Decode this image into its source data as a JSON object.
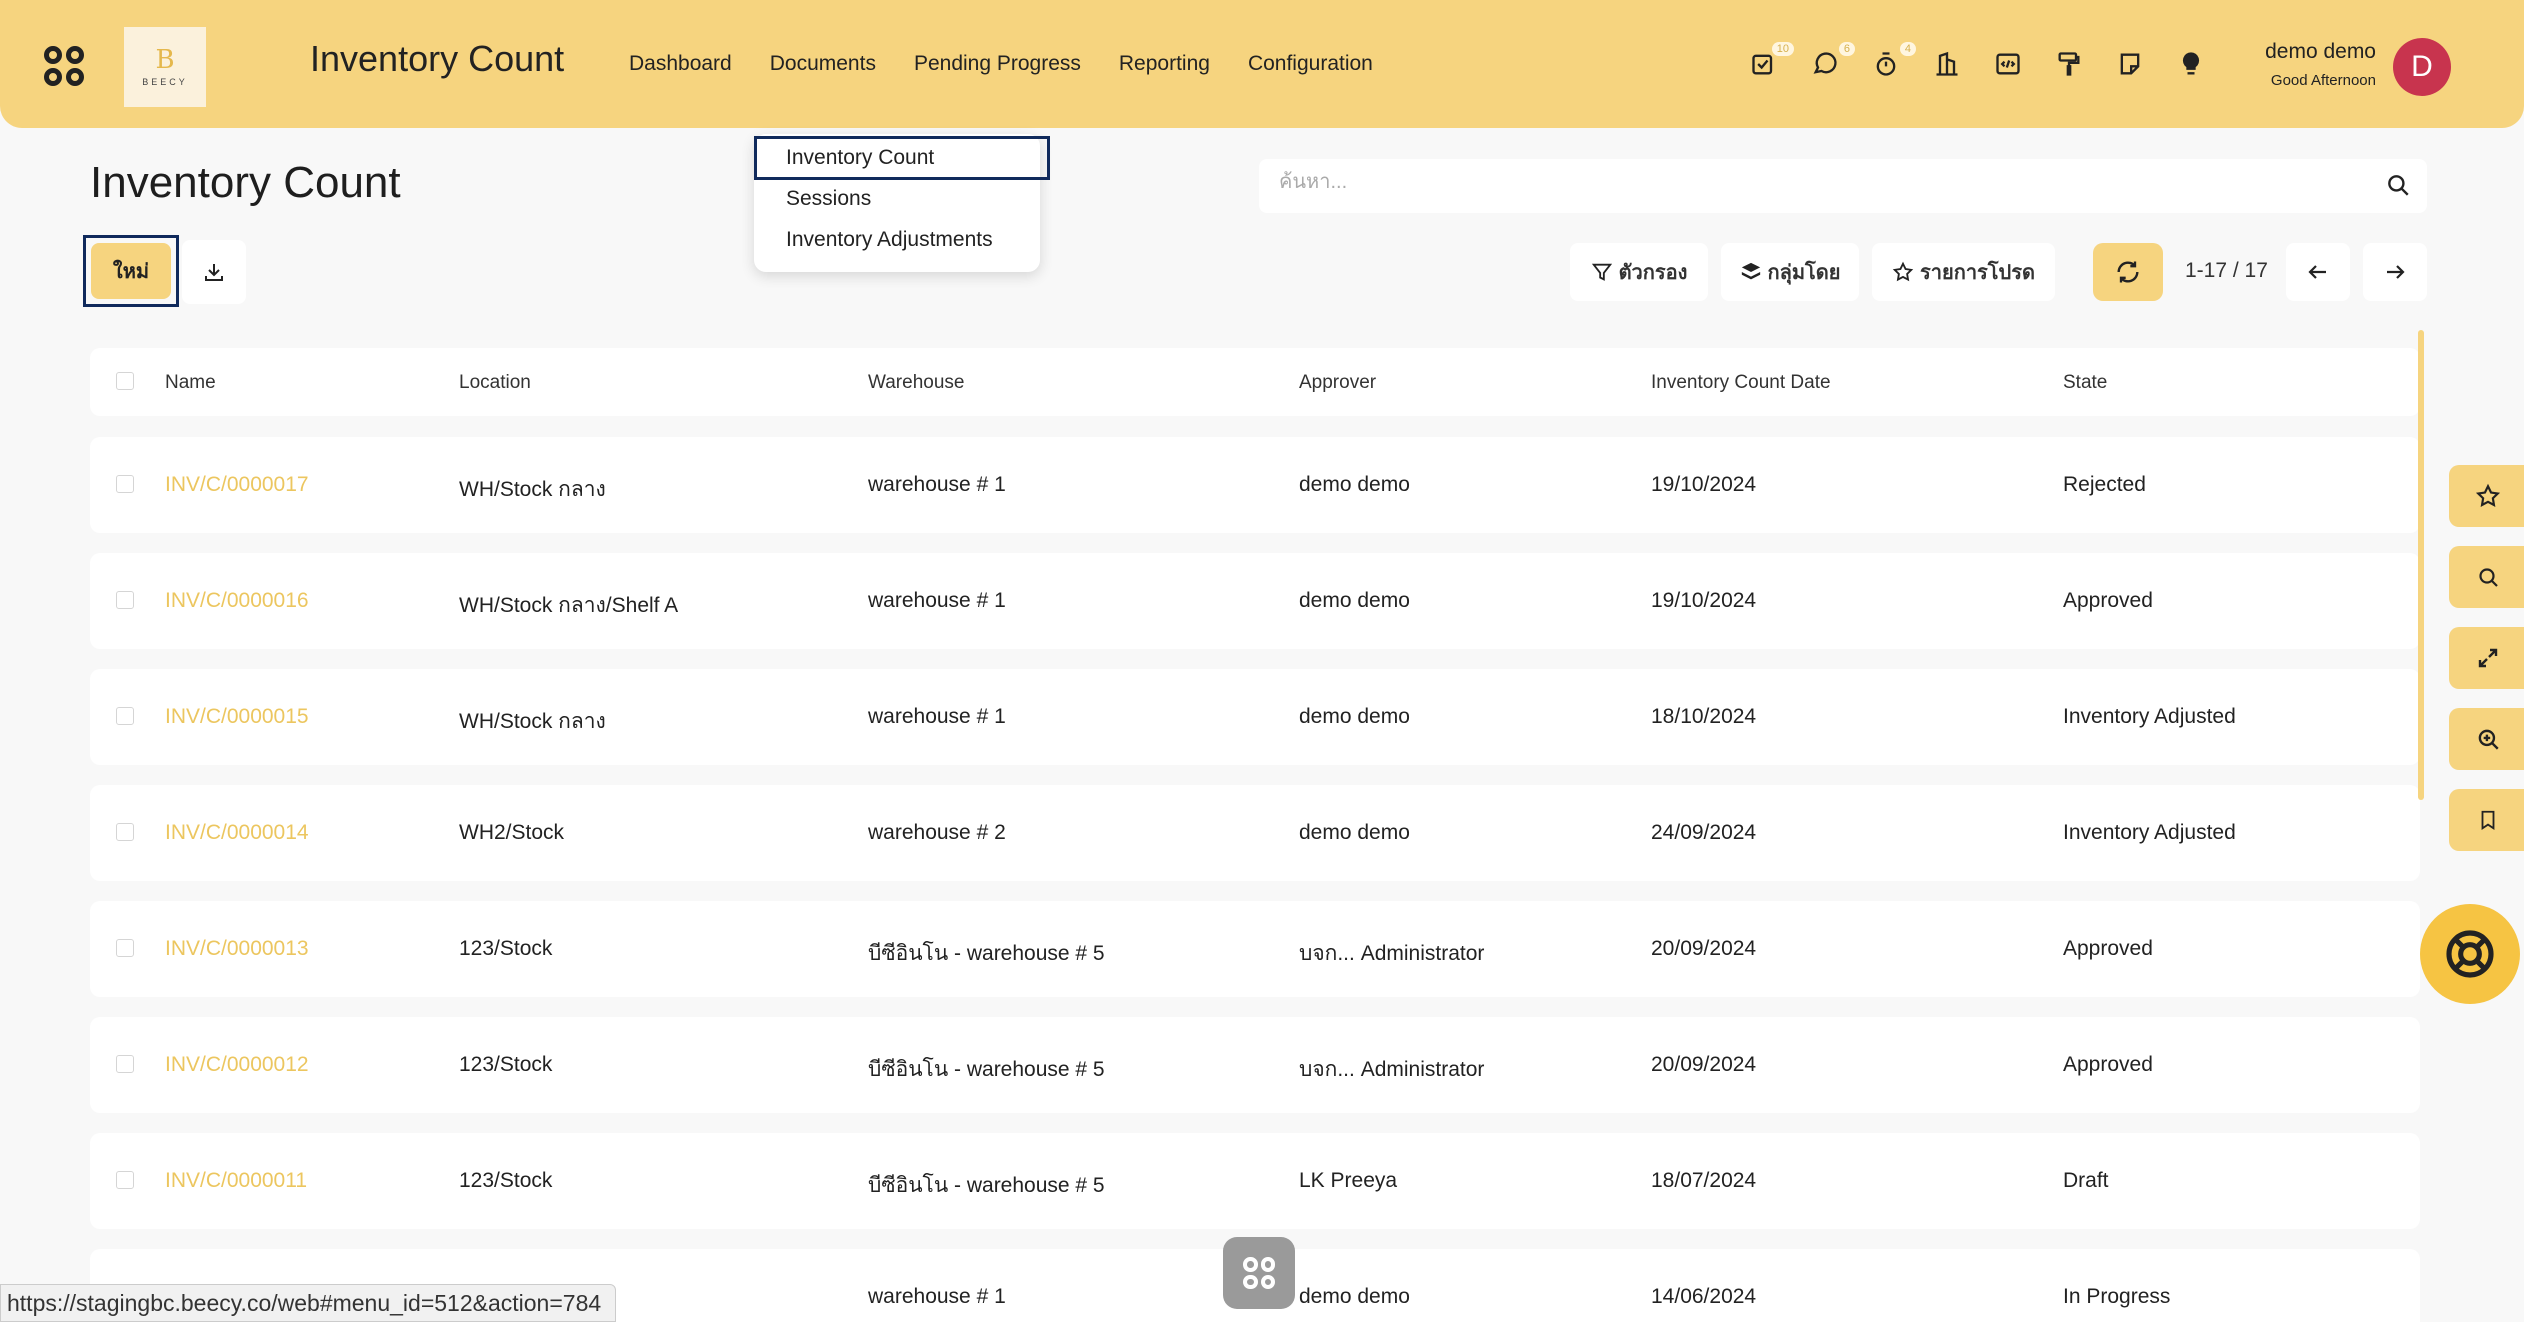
{
  "header": {
    "app_title": "Inventory Count",
    "logo_text": "BEECY",
    "nav": [
      "Dashboard",
      "Documents",
      "Pending Progress",
      "Reporting",
      "Configuration"
    ],
    "icons": [
      {
        "name": "activity-icon",
        "badge": "10"
      },
      {
        "name": "chat-icon",
        "badge": "6"
      },
      {
        "name": "timer-icon",
        "badge": "4"
      },
      {
        "name": "building-icon",
        "badge": ""
      },
      {
        "name": "code-icon",
        "badge": ""
      },
      {
        "name": "paint-roller-icon",
        "badge": ""
      },
      {
        "name": "note-icon",
        "badge": ""
      },
      {
        "name": "lightbulb-icon",
        "badge": ""
      }
    ],
    "user_name": "demo demo",
    "greeting": "Good Afternoon",
    "avatar_letter": "D"
  },
  "page": {
    "title": "Inventory Count",
    "new_label": "ใหม่",
    "search_placeholder": "ค้นหา...",
    "filter_label": "ตัวกรอง",
    "group_label": "กลุ่มโดย",
    "favorites_label": "รายการโปรด",
    "pager": "1-17 / 17"
  },
  "dropdown": {
    "items": [
      "Inventory Count",
      "Sessions",
      "Inventory Adjustments"
    ]
  },
  "table": {
    "columns": [
      "Name",
      "Location",
      "Warehouse",
      "Approver",
      "Inventory Count Date",
      "State"
    ],
    "rows": [
      {
        "name": "INV/C/0000017",
        "location": "WH/Stock กลาง",
        "warehouse": "warehouse # 1",
        "approver": "demo demo",
        "date": "19/10/2024",
        "state": "Rejected"
      },
      {
        "name": "INV/C/0000016",
        "location": "WH/Stock กลาง/Shelf A",
        "warehouse": "warehouse # 1",
        "approver": "demo demo",
        "date": "19/10/2024",
        "state": "Approved"
      },
      {
        "name": "INV/C/0000015",
        "location": "WH/Stock กลาง",
        "warehouse": "warehouse # 1",
        "approver": "demo demo",
        "date": "18/10/2024",
        "state": "Inventory Adjusted"
      },
      {
        "name": "INV/C/0000014",
        "location": "WH2/Stock",
        "warehouse": "warehouse # 2",
        "approver": "demo demo",
        "date": "24/09/2024",
        "state": "Inventory Adjusted"
      },
      {
        "name": "INV/C/0000013",
        "location": "123/Stock",
        "warehouse": "บีซีอินโน - warehouse # 5",
        "approver": "บจก... Administrator",
        "date": "20/09/2024",
        "state": "Approved"
      },
      {
        "name": "INV/C/0000012",
        "location": "123/Stock",
        "warehouse": "บีซีอินโน - warehouse # 5",
        "approver": "บจก... Administrator",
        "date": "20/09/2024",
        "state": "Approved"
      },
      {
        "name": "INV/C/0000011",
        "location": "123/Stock",
        "warehouse": "บีซีอินโน - warehouse # 5",
        "approver": "LK Preeya",
        "date": "18/07/2024",
        "state": "Draft"
      },
      {
        "name": "",
        "location": "",
        "warehouse": "warehouse # 1",
        "approver": "demo demo",
        "date": "14/06/2024",
        "state": "In Progress"
      }
    ]
  },
  "side_buttons": [
    "star-icon",
    "search-icon",
    "expand-icon",
    "zoom-in-icon",
    "bookmark-icon"
  ],
  "status_url": "https://stagingbc.beecy.co/web#menu_id=512&action=784",
  "colors": {
    "accent": "#f6d47f",
    "link": "#ecc65f",
    "focus": "#102a5c",
    "avatar": "#c8344e"
  }
}
